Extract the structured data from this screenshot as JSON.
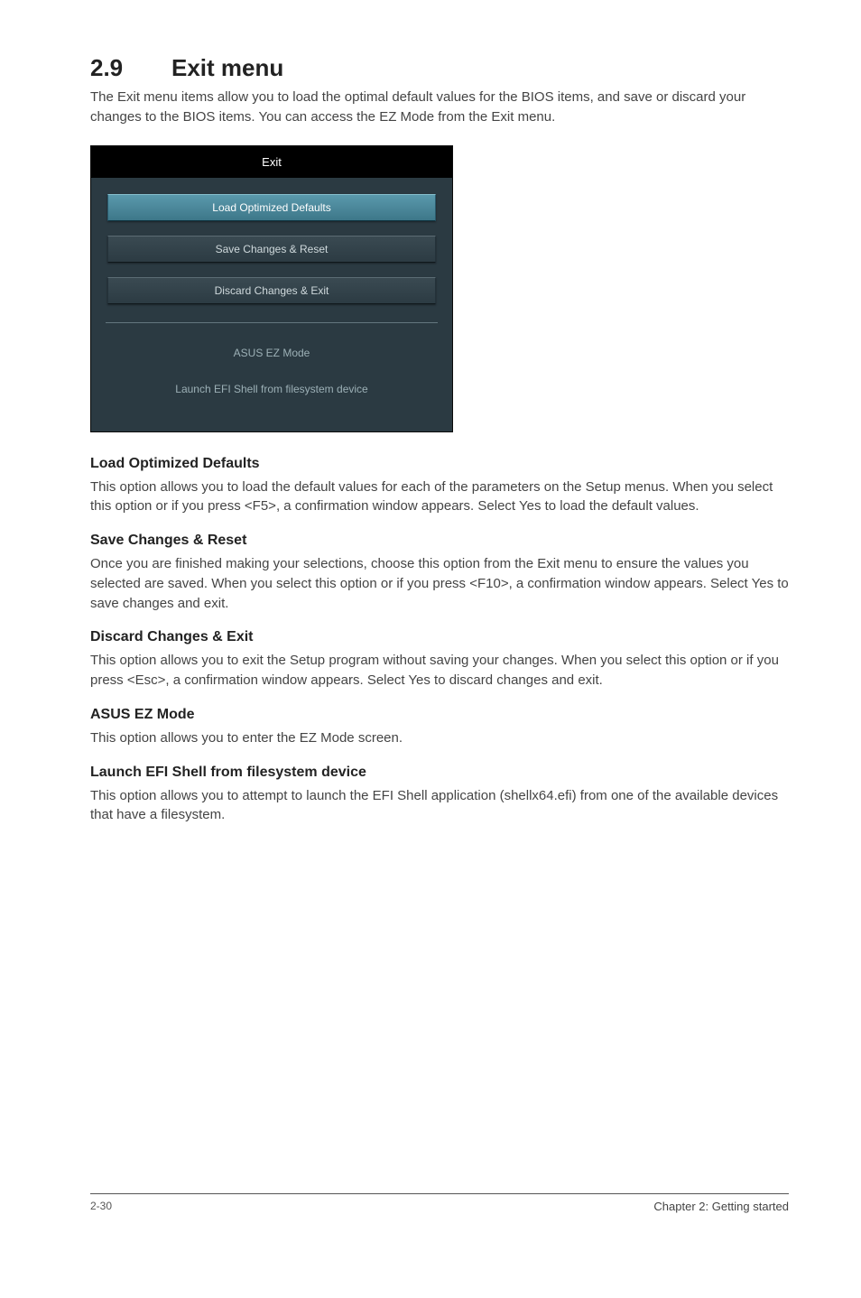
{
  "section": {
    "number": "2.9",
    "title": "Exit menu",
    "intro": "The Exit menu items allow you to load the optimal default values for the BIOS items, and save or discard your changes to the BIOS items. You can access the EZ Mode from the Exit menu."
  },
  "panel": {
    "header": "Exit",
    "buttons": [
      {
        "label": "Load Optimized Defaults",
        "selected": true
      },
      {
        "label": "Save Changes & Reset",
        "selected": false
      },
      {
        "label": "Discard Changes & Exit",
        "selected": false
      }
    ],
    "links": [
      {
        "label": "ASUS EZ Mode"
      },
      {
        "label": "Launch EFI Shell from filesystem device"
      }
    ]
  },
  "options": [
    {
      "heading": "Load Optimized Defaults",
      "body": "This option allows you to load the default values for each of the parameters on the Setup menus. When you select this option or if you press <F5>, a confirmation window appears. Select Yes to load the default values."
    },
    {
      "heading": "Save Changes & Reset",
      "body": "Once you are finished making your selections, choose this option from the Exit menu to ensure the values you selected are saved. When you select this option or if you press <F10>, a confirmation window appears. Select Yes to save changes and exit."
    },
    {
      "heading": "Discard Changes & Exit",
      "body": "This option allows you to exit the Setup program without saving your changes. When you select this option or if you press <Esc>, a confirmation window appears. Select Yes to discard changes and exit."
    },
    {
      "heading": "ASUS EZ Mode",
      "body": "This option allows you to enter the EZ Mode screen."
    },
    {
      "heading": "Launch EFI Shell from filesystem device",
      "body": "This option allows you to attempt to launch the EFI Shell application (shellx64.efi) from one of the available devices that have a filesystem."
    }
  ],
  "footer": {
    "page": "2-30",
    "chapter": "Chapter 2: Getting started"
  }
}
